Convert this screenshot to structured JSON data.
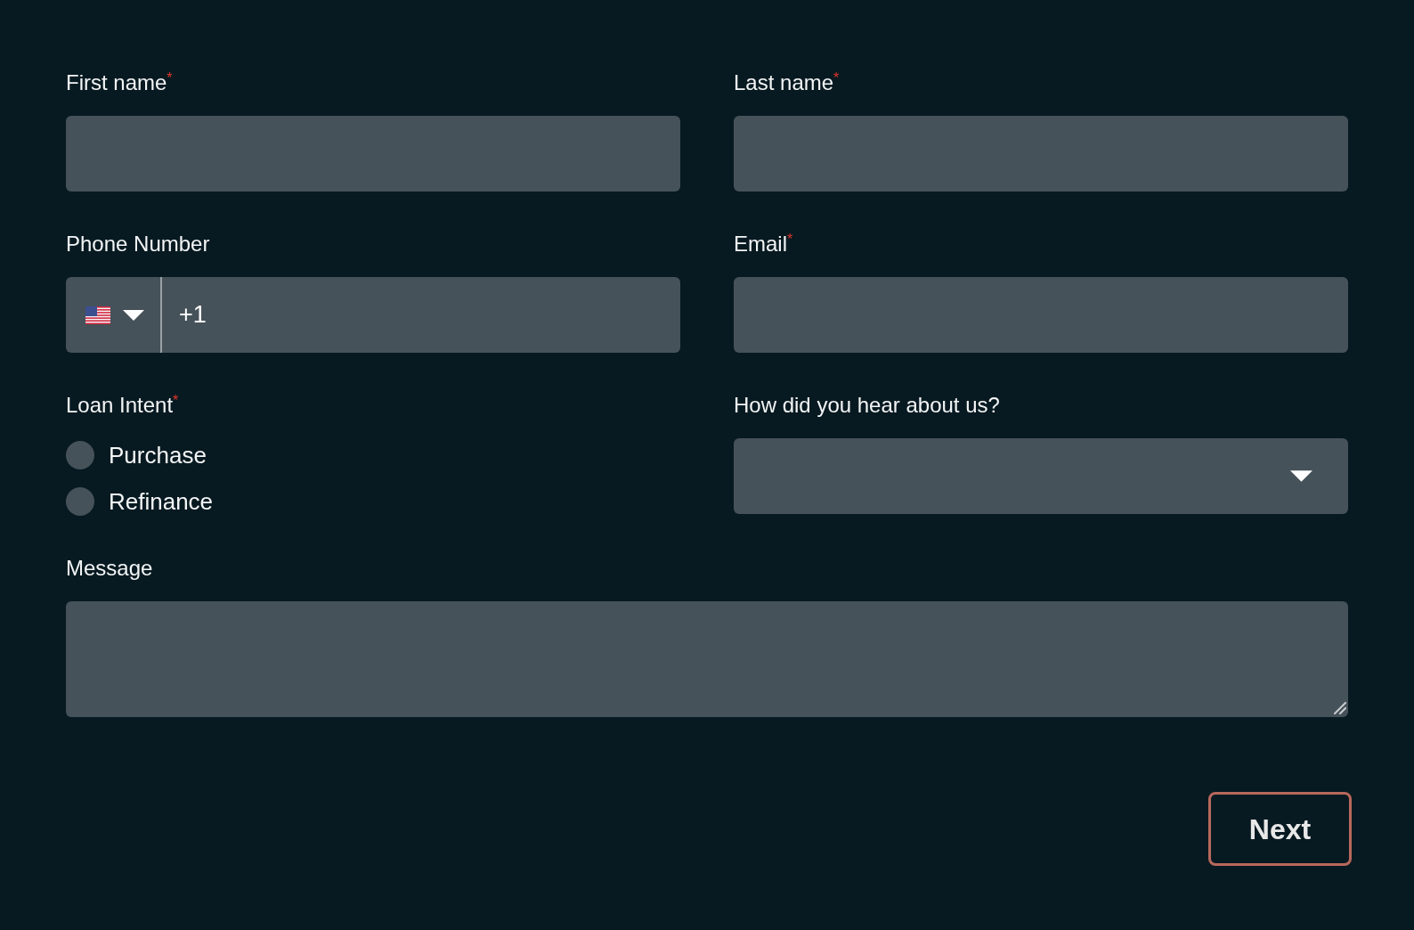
{
  "fields": [
    {
      "kind": "text",
      "label": "First name$^{*}$"
    },
    {
      "kind": "text",
      "label": "Last name$^{*}$"
    },
    {
      "kind": "phone",
      "label": "Phone Number",
      "value": "+1"
    },
    {
      "kind": "text",
      "label": "Email$^{*}$"
    },
    {
      "kind": "radio",
      "label": "Loan Intent$^{*}$",
      "options": [
        {
          "label": "Purchase",
          "selected": false
        },
        {
          "label": "Refinance",
          "selected": false
        }
      ]
    },
    {
      "kind": "select",
      "label": "How did you hear about us?"
    },
    {
      "kind": "textarea",
      "label": "Message"
    }
  ],
  "buttons": [
    {
      "label": "Next"
    }
  ]
}
